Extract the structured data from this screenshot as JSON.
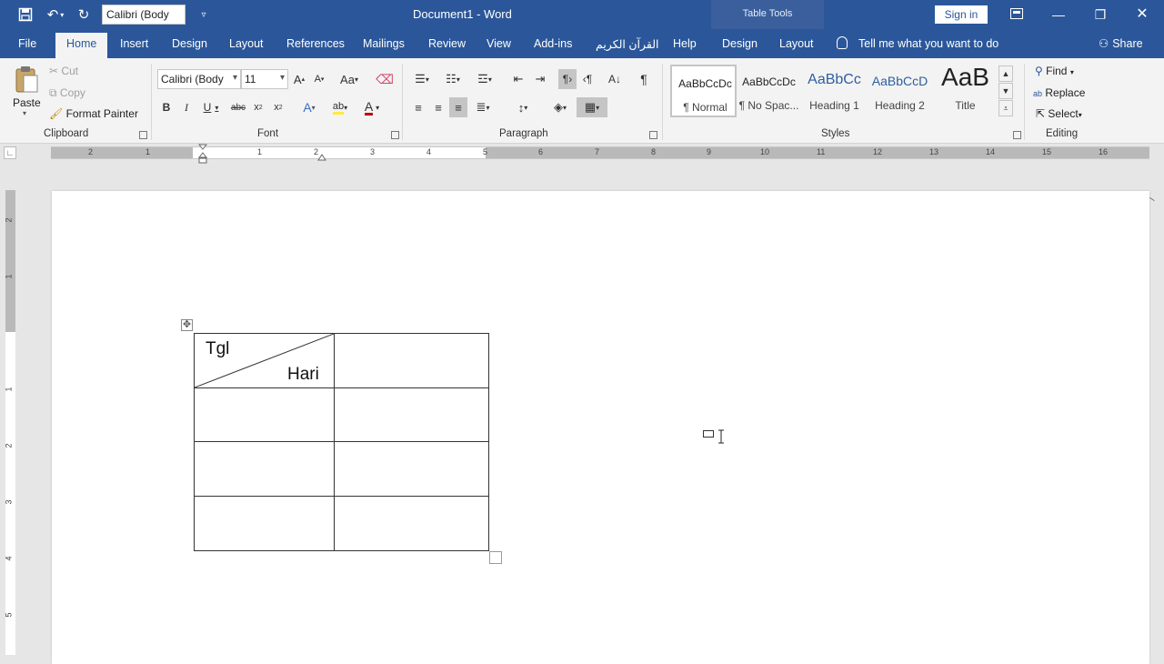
{
  "titlebar": {
    "font_box": "Calibri (Body",
    "title": "Document1  -  Word",
    "table_tools": "Table Tools",
    "sign_in": "Sign in"
  },
  "tabs": [
    "File",
    "Home",
    "Insert",
    "Design",
    "Layout",
    "References",
    "Mailings",
    "Review",
    "View",
    "Add-ins",
    "القرآن الكريم",
    "Help",
    "Design",
    "Layout"
  ],
  "active_tab": "Home",
  "tell_me": "Tell me what you want to do",
  "share": "Share",
  "clipboard": {
    "paste": "Paste",
    "cut": "Cut",
    "copy": "Copy",
    "format_painter": "Format Painter",
    "label": "Clipboard"
  },
  "font": {
    "name": "Calibri (Body",
    "size": "11",
    "label": "Font"
  },
  "paragraph": {
    "label": "Paragraph"
  },
  "styles": {
    "items": [
      {
        "sample": "AaBbCcDc",
        "name": "¶ Normal"
      },
      {
        "sample": "AaBbCcDc",
        "name": "¶ No Spac..."
      },
      {
        "sample": "AaBbCc",
        "name": "Heading 1"
      },
      {
        "sample": "AaBbCcD",
        "name": "Heading 2"
      },
      {
        "sample": "AaB",
        "name": "Title"
      }
    ],
    "label": "Styles"
  },
  "editing": {
    "find": "Find",
    "replace": "Replace",
    "select": "Select",
    "label": "Editing"
  },
  "ruler": {
    "h_numbers": [
      "2",
      "1",
      "1",
      "2",
      "3",
      "4",
      "5",
      "6",
      "7",
      "8",
      "9",
      "10",
      "11",
      "12",
      "13",
      "14",
      "15",
      "16"
    ],
    "v_numbers": [
      "2",
      "1",
      "1",
      "2",
      "3",
      "4",
      "5"
    ]
  },
  "document": {
    "table": {
      "header_top_left": "Tgl",
      "header_bottom_right": "Hari"
    }
  },
  "colors": {
    "accent": "#2b579a",
    "table_tools": "#3a5f9c",
    "font_color_underline": "#c00000"
  }
}
